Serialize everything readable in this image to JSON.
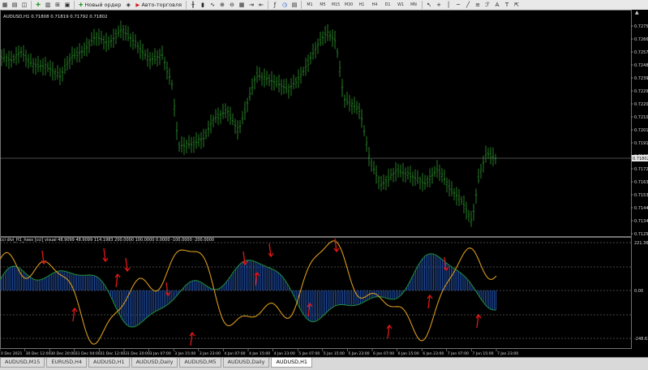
{
  "toolbar": {
    "new_order_label": "Новый ордер",
    "autotrading_label": "Авто-торговля",
    "timeframes": [
      "M1",
      "M5",
      "M15",
      "M30",
      "H1",
      "H4",
      "D1",
      "W1",
      "MN"
    ],
    "icons": [
      "new-chart-icon",
      "profiles-icon",
      "market-watch-icon",
      "navigator-icon",
      "terminal-icon",
      "strategy-tester-icon",
      "new-order-icon",
      "metaeditor-icon",
      "autotrading-icon",
      "bar-chart-icon",
      "candlestick-icon",
      "line-chart-icon",
      "zoom-in-icon",
      "zoom-out-icon",
      "tile-icon",
      "autoscroll-icon",
      "chart-shift-icon",
      "indicators-icon",
      "periods-icon",
      "templates-icon",
      "cursor-icon",
      "crosshair-icon",
      "vertical-line-icon",
      "horizontal-line-icon",
      "trend-line-icon",
      "text-icon",
      "arrow-icon"
    ]
  },
  "chart": {
    "info": "AUDUSD,H1  0.71808 0.71819 0.71792 0.71802",
    "current_price": "0.71802",
    "price_labels": [
      "0.72755",
      "0.72660",
      "0.72575",
      "0.72485",
      "0.72390",
      "0.72295",
      "0.72200",
      "0.72105",
      "0.72010",
      "0.71915",
      "0.71820",
      "0.71725",
      "0.71630",
      "0.71535",
      "0.71440",
      "0.71345",
      "0.71250"
    ],
    "indicator_info": "cci divi_H1_hsex [cci] visual  48.9099 48.9099 114.1983 200.0000 100.0000 0.0000 -100.0000 -200.0000",
    "indicator_labels": [
      "221.3637",
      "0.00",
      "-248.6369"
    ],
    "time_labels": [
      "0 Dec 2021",
      "30 Dec 12:00",
      "30 Dec 20:00",
      "31 Dec 04:00",
      "31 Dec 12:00",
      "31 Dec 20:00",
      "3 Jan 07:00",
      "3 Jan 15:00",
      "3 Jan 23:00",
      "4 Jan 07:00",
      "4 Jan 15:00",
      "4 Jan 23:00",
      "5 Jan 07:00",
      "5 Jan 15:00",
      "5 Jan 23:00",
      "6 Jan 07:00",
      "6 Jan 15:00",
      "6 Jan 23:00",
      "7 Jan 07:00",
      "7 Jan 15:00",
      "7 Jan 23:00"
    ]
  },
  "tabs": [
    "AUDUSD,M15",
    "EURUSD,H4",
    "AUDUSD,H1",
    "AUDUSD,Daily",
    "AUDUSD,M5",
    "AUDUSD,Daily",
    "AUDUSD,H1"
  ],
  "active_tab_index": 6,
  "colors": {
    "bars": "#2e9b2e",
    "cci": "#d89a1e",
    "signal": "#1f8f3a",
    "histogram": "#2355b5",
    "arrows": "#e01818",
    "hline": "#8a8a8a"
  }
}
